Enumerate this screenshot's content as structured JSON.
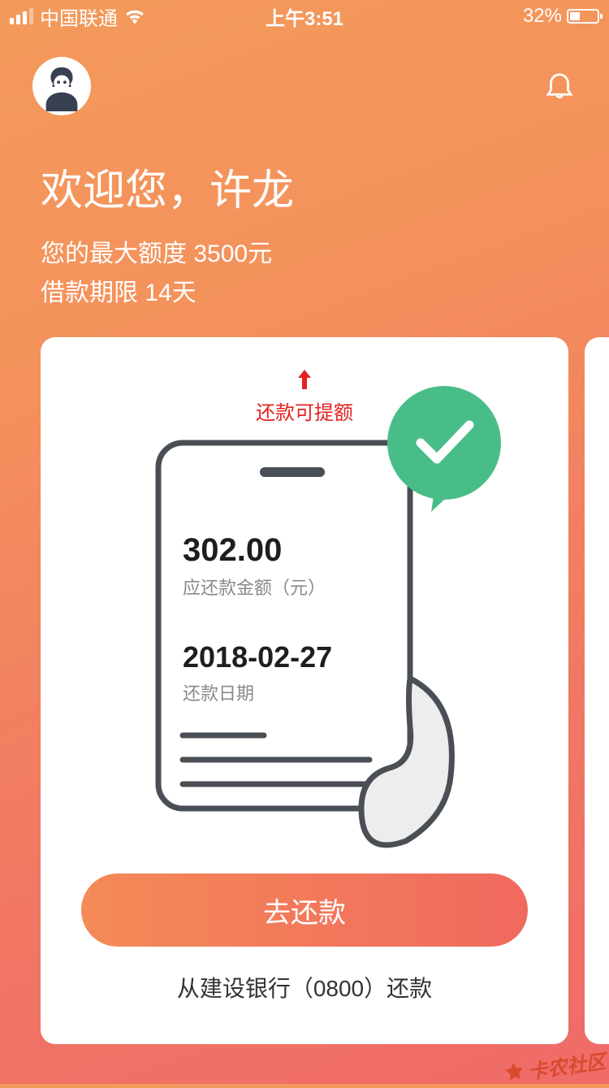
{
  "status_bar": {
    "carrier": "中国联通",
    "time": "上午3:51",
    "battery_percent": "32%"
  },
  "welcome": {
    "title": "欢迎您，许龙",
    "credit_line": "您的最大额度 3500元",
    "loan_period": "借款期限 14天"
  },
  "card": {
    "tooltip": "还款可提额",
    "amount_value": "302.00",
    "amount_label": "应还款金额（元）",
    "date_value": "2018-02-27",
    "date_label": "还款日期",
    "button": "去还款",
    "bank_info": "从建设银行（0800）还款"
  },
  "watermark": "卡农社区"
}
